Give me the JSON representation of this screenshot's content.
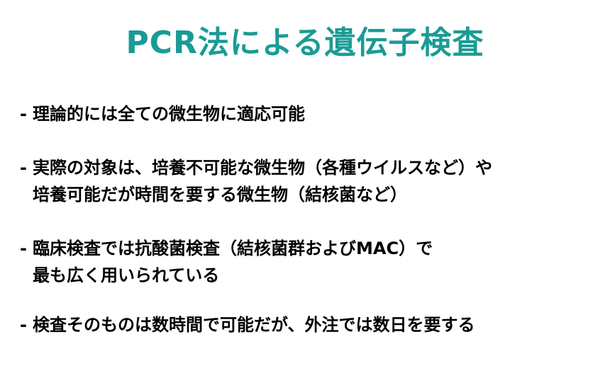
{
  "theme": {
    "title_color": "#1a9b95",
    "text_color": "#000000",
    "background": "#ffffff"
  },
  "slide": {
    "title": "PCR法による遺伝子検査",
    "bullet_marker": "-",
    "bullets": [
      {
        "lines": [
          "理論的には全ての微生物に適応可能"
        ]
      },
      {
        "lines": [
          "実際の対象は、培養不可能な微生物（各種ウイルスなど）や",
          "培養可能だが時間を要する微生物（結核菌など）"
        ]
      },
      {
        "lines": [
          "臨床検査では抗酸菌検査（結核菌群およびMAC）で",
          "最も広く用いられている"
        ]
      },
      {
        "lines": [
          "検査そのものは数時間で可能だが、外注では数日を要する"
        ]
      }
    ]
  }
}
